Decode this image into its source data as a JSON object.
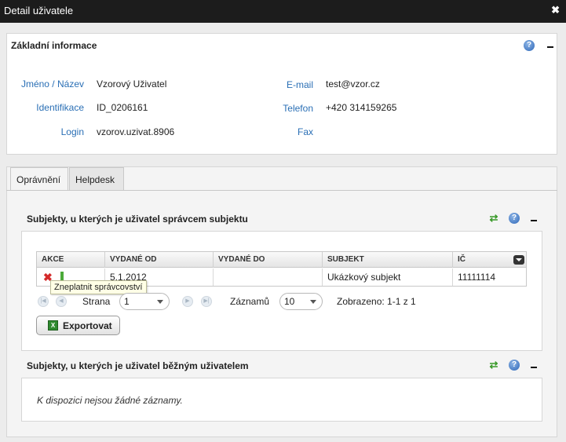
{
  "window": {
    "title": "Detail uživatele",
    "close": "✖"
  },
  "basic": {
    "title": "Základní informace",
    "fields_left": [
      {
        "label": "Jméno / Název",
        "value": "Vzorový Uživatel"
      },
      {
        "label": "Identifikace",
        "value": "ID_0206161"
      },
      {
        "label": "Login",
        "value": "vzorov.uzivat.8906"
      }
    ],
    "fields_right": [
      {
        "label": "E-mail",
        "value": "test@vzor.cz"
      },
      {
        "label": "Telefon",
        "value": "+420 314159265"
      },
      {
        "label": "Fax",
        "value": ""
      }
    ]
  },
  "tabs": [
    {
      "label": "Oprávnění",
      "active": true
    },
    {
      "label": "Helpdesk",
      "active": false
    }
  ],
  "admin_section": {
    "title": "Subjekty, u kterých je uživatel správcem subjektu",
    "columns": [
      "AKCE",
      "VYDANÉ OD",
      "VYDANÉ DO",
      "SUBJEKT",
      "IČ"
    ],
    "rows": [
      {
        "vydane_od": "5.1.2012",
        "vydane_do": "",
        "subjekt": "Ukázkový subjekt",
        "ic": "11111114"
      }
    ],
    "tooltip": "Zneplatnit správcovství",
    "pager": {
      "page_label": "Strana",
      "page_value": "1",
      "records_label": "Záznamů",
      "records_value": "10",
      "shown": "Zobrazeno: 1-1 z 1"
    },
    "export_label": "Exportovat"
  },
  "user_section": {
    "title": "Subjekty, u kterých je uživatel běžným uživatelem",
    "empty": "K dispozici nejsou žádné záznamy."
  },
  "colors": {
    "link_blue": "#2a6fb5",
    "titlebar": "#1c1c1c",
    "refresh_green": "#3a9a2a",
    "delete_red": "#d42a2a"
  }
}
